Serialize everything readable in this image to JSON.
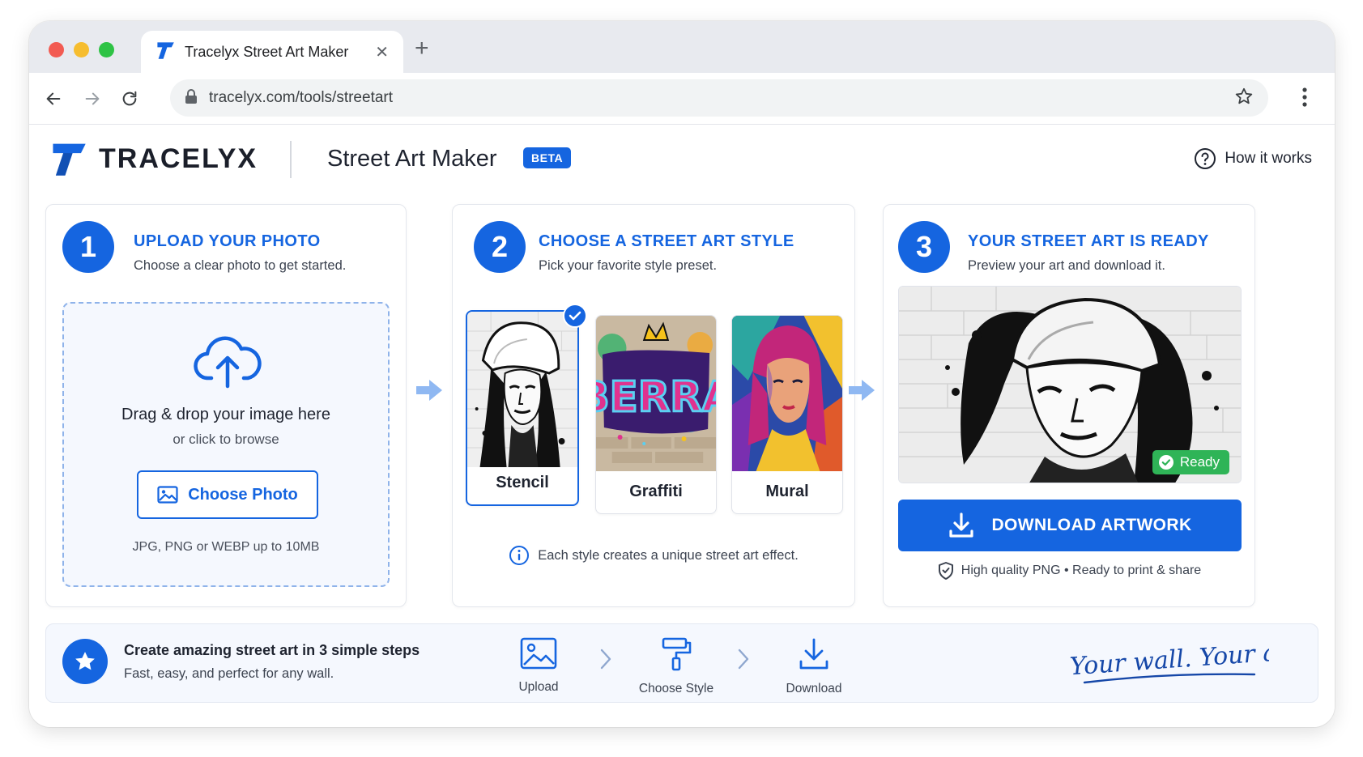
{
  "browser": {
    "tab_title": "Tracelyx Street Art Maker",
    "url": "tracelyx.com/tools/streetart"
  },
  "header": {
    "brand": "TRACELYX",
    "app_title": "Street Art Maker",
    "badge": "BETA",
    "help_link": "How it works"
  },
  "step1": {
    "number": "1",
    "title": "UPLOAD YOUR PHOTO",
    "subtitle": "Choose a clear photo to get started.",
    "drop_text": "Drag & drop your image here",
    "browse_text": "or click to browse",
    "button": "Choose Photo",
    "formats": "JPG, PNG or WEBP up to 10MB"
  },
  "step2": {
    "number": "2",
    "title": "CHOOSE A STREET ART STYLE",
    "subtitle": "Pick your favorite style preset.",
    "styles": [
      {
        "label": "Stencil",
        "selected": true
      },
      {
        "label": "Graffiti",
        "selected": false
      },
      {
        "label": "Mural",
        "selected": false
      }
    ],
    "note": "Each style creates a unique street art effect."
  },
  "step3": {
    "number": "3",
    "title": "YOUR STREET ART IS READY",
    "subtitle": "Preview your art and download it.",
    "status": "Ready",
    "button": "DOWNLOAD ARTWORK",
    "quality": "High quality PNG • Ready to print & share"
  },
  "footer": {
    "title": "Create amazing street art in 3 simple steps",
    "subtitle": "Fast, easy, and perfect for any wall.",
    "steps": [
      "Upload",
      "Choose Style",
      "Download"
    ],
    "slogan": "Your wall. Your art."
  },
  "colors": {
    "accent": "#1565e0",
    "ready": "#2fb457",
    "graffiti_letters": "BERRA"
  }
}
